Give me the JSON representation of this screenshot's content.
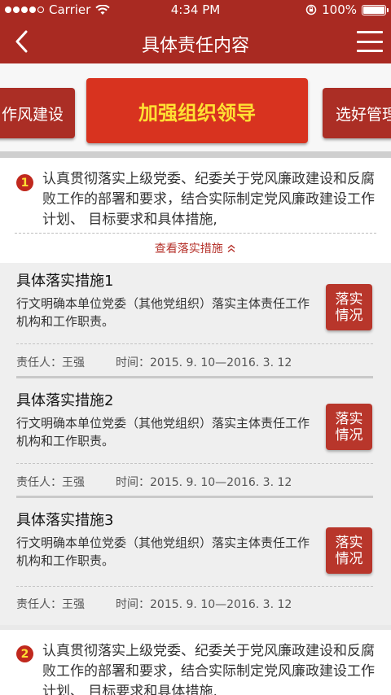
{
  "status_bar": {
    "carrier": "Carrier",
    "time": "4:34 PM",
    "battery": "100%"
  },
  "nav": {
    "title": "具体责任内容"
  },
  "tabs": {
    "left": "作风建设",
    "active": "加强组织领导",
    "right": "选好管理"
  },
  "cards": [
    {
      "number": "1",
      "text": "认真贯彻落实上级党委、纪委关于党风廉政建设和反腐败工作的部署和要求，结合实际制定党风廉政建设工作计划、 目标要求和具体措施,",
      "toggle": "查看落实措施"
    },
    {
      "number": "2",
      "text": "认真贯彻落实上级党委、纪委关于党风廉政建设和反腐败工作的部署和要求，结合实际制定党风廉政建设工作计划、 目标要求和具体措施,"
    }
  ],
  "measures": [
    {
      "title": "具体落实措施1",
      "desc": "行文明确本单位党委（其他党组织）落实主体责任工作机构和工作职责。",
      "button": "落实情况",
      "owner": "责任人：王强",
      "period": "时间：2015. 9. 10—2016. 3. 12"
    },
    {
      "title": "具体落实措施2",
      "desc": "行文明确本单位党委（其他党组织）落实主体责任工作机构和工作职责。",
      "button": "落实情况",
      "owner": "责任人：王强",
      "period": "时间：2015. 9. 10—2016. 3. 12"
    },
    {
      "title": "具体落实措施3",
      "desc": "行文明确本单位党委（其他党组织）落实主体责任工作机构和工作职责。",
      "button": "落实情况",
      "owner": "责任人：王强",
      "period": "时间：2015. 9. 10—2016. 3. 12"
    }
  ]
}
